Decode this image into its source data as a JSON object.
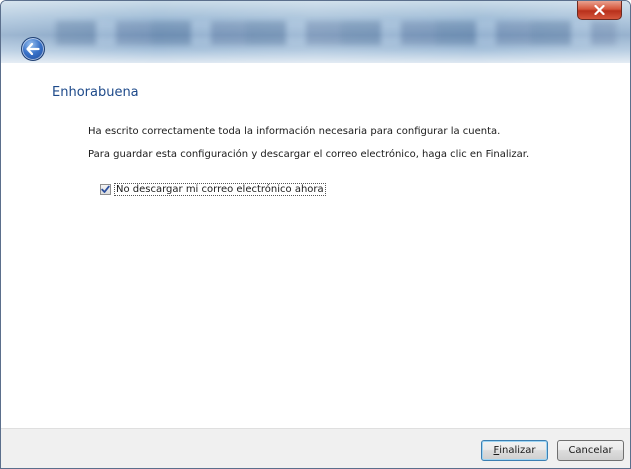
{
  "window": {
    "close_icon": "close-icon",
    "back_icon": "back-arrow-icon"
  },
  "main": {
    "heading": "Enhorabuena",
    "paragraph1": "Ha escrito correctamente toda la información necesaria para configurar la cuenta.",
    "paragraph2": "Para guardar esta configuración y descargar el correo electrónico, haga clic en Finalizar.",
    "checkbox": {
      "label": "No descargar mi correo electrónico ahora",
      "checked": true
    }
  },
  "footer": {
    "finish_accel": "F",
    "finish_rest": "inalizar",
    "cancel_label": "Cancelar"
  },
  "colors": {
    "heading": "#1e4a8a",
    "footer_bg": "#f0f0f0",
    "close_red": "#d5563c"
  }
}
